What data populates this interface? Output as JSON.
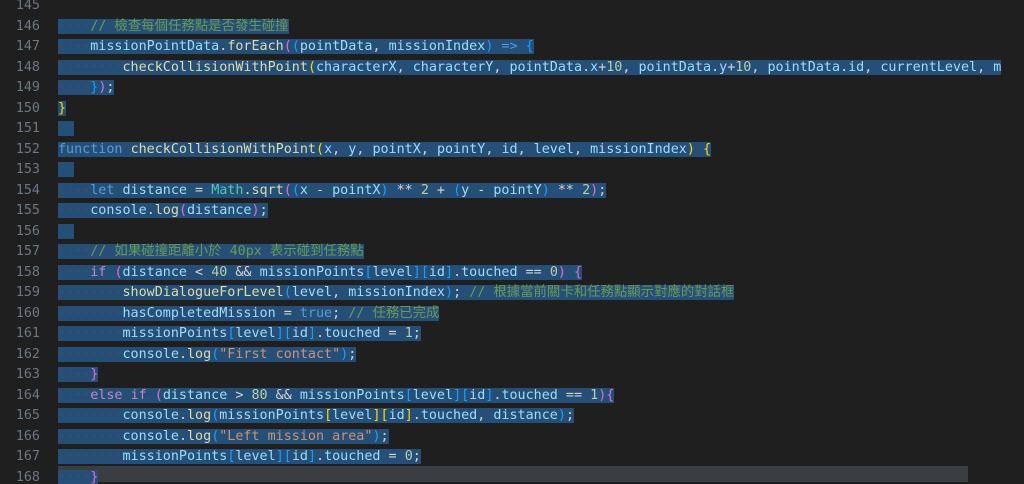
{
  "editor": {
    "lines": [
      {
        "num": "145",
        "tokens": [
          {
            "t": "",
            "c": "pl"
          }
        ],
        "sel": false
      },
      {
        "num": "146",
        "tokens": [
          {
            "t": "····",
            "c": "ws"
          },
          {
            "t": "// 檢查每個任務點是否發生碰撞",
            "c": "com"
          }
        ],
        "sel": true
      },
      {
        "num": "147",
        "tokens": [
          {
            "t": "····",
            "c": "ws"
          },
          {
            "t": "missionPointData",
            "c": "var"
          },
          {
            "t": ".",
            "c": "op"
          },
          {
            "t": "forEach",
            "c": "fn"
          },
          {
            "t": "(",
            "c": "b2"
          },
          {
            "t": "(",
            "c": "b3"
          },
          {
            "t": "pointData",
            "c": "var"
          },
          {
            "t": ", ",
            "c": "op"
          },
          {
            "t": "missionIndex",
            "c": "var"
          },
          {
            "t": ")",
            "c": "b3"
          },
          {
            "t": " ",
            "c": "op"
          },
          {
            "t": "=>",
            "c": "kw"
          },
          {
            "t": " ",
            "c": "op"
          },
          {
            "t": "{",
            "c": "b3"
          }
        ],
        "sel": true
      },
      {
        "num": "148",
        "tokens": [
          {
            "t": "········",
            "c": "ws"
          },
          {
            "t": "checkCollisionWithPoint",
            "c": "fn"
          },
          {
            "t": "(",
            "c": "b1"
          },
          {
            "t": "characterX",
            "c": "var"
          },
          {
            "t": ", ",
            "c": "op"
          },
          {
            "t": "characterY",
            "c": "var"
          },
          {
            "t": ", ",
            "c": "op"
          },
          {
            "t": "pointData",
            "c": "var"
          },
          {
            "t": ".",
            "c": "op"
          },
          {
            "t": "x",
            "c": "var"
          },
          {
            "t": "+",
            "c": "op"
          },
          {
            "t": "10",
            "c": "num"
          },
          {
            "t": ", ",
            "c": "op"
          },
          {
            "t": "pointData",
            "c": "var"
          },
          {
            "t": ".",
            "c": "op"
          },
          {
            "t": "y",
            "c": "var"
          },
          {
            "t": "+",
            "c": "op"
          },
          {
            "t": "10",
            "c": "num"
          },
          {
            "t": ", ",
            "c": "op"
          },
          {
            "t": "pointData",
            "c": "var"
          },
          {
            "t": ".",
            "c": "op"
          },
          {
            "t": "id",
            "c": "var"
          },
          {
            "t": ", ",
            "c": "op"
          },
          {
            "t": "currentLevel",
            "c": "var"
          },
          {
            "t": ", ",
            "c": "op"
          },
          {
            "t": "m",
            "c": "var"
          }
        ],
        "sel": true
      },
      {
        "num": "149",
        "tokens": [
          {
            "t": "····",
            "c": "ws"
          },
          {
            "t": "}",
            "c": "b3"
          },
          {
            "t": ")",
            "c": "b2"
          },
          {
            "t": ";",
            "c": "op"
          }
        ],
        "sel": true
      },
      {
        "num": "150",
        "tokens": [
          {
            "t": "}",
            "c": "b1"
          }
        ],
        "sel": true
      },
      {
        "num": "151",
        "tokens": [
          {
            "t": "",
            "c": "pl"
          }
        ],
        "sel": true
      },
      {
        "num": "152",
        "tokens": [
          {
            "t": "function",
            "c": "kw"
          },
          {
            "t": " ",
            "c": "op"
          },
          {
            "t": "checkCollisionWithPoint",
            "c": "fn"
          },
          {
            "t": "(",
            "c": "b1"
          },
          {
            "t": "x",
            "c": "var"
          },
          {
            "t": ", ",
            "c": "op"
          },
          {
            "t": "y",
            "c": "var"
          },
          {
            "t": ", ",
            "c": "op"
          },
          {
            "t": "pointX",
            "c": "var"
          },
          {
            "t": ", ",
            "c": "op"
          },
          {
            "t": "pointY",
            "c": "var"
          },
          {
            "t": ", ",
            "c": "op"
          },
          {
            "t": "id",
            "c": "var"
          },
          {
            "t": ", ",
            "c": "op"
          },
          {
            "t": "level",
            "c": "var"
          },
          {
            "t": ", ",
            "c": "op"
          },
          {
            "t": "missionIndex",
            "c": "var"
          },
          {
            "t": ")",
            "c": "b1"
          },
          {
            "t": " ",
            "c": "op"
          },
          {
            "t": "{",
            "c": "b1"
          }
        ],
        "sel": true
      },
      {
        "num": "153",
        "tokens": [
          {
            "t": "",
            "c": "pl"
          }
        ],
        "sel": true
      },
      {
        "num": "154",
        "tokens": [
          {
            "t": "····",
            "c": "ws"
          },
          {
            "t": "let",
            "c": "kw"
          },
          {
            "t": " ",
            "c": "op"
          },
          {
            "t": "distance",
            "c": "var"
          },
          {
            "t": " = ",
            "c": "op"
          },
          {
            "t": "Math",
            "c": "cls"
          },
          {
            "t": ".",
            "c": "op"
          },
          {
            "t": "sqrt",
            "c": "fn"
          },
          {
            "t": "(",
            "c": "b2"
          },
          {
            "t": "(",
            "c": "b3"
          },
          {
            "t": "x",
            "c": "var"
          },
          {
            "t": " - ",
            "c": "op"
          },
          {
            "t": "pointX",
            "c": "var"
          },
          {
            "t": ")",
            "c": "b3"
          },
          {
            "t": " ** ",
            "c": "op"
          },
          {
            "t": "2",
            "c": "num"
          },
          {
            "t": " + ",
            "c": "op"
          },
          {
            "t": "(",
            "c": "b3"
          },
          {
            "t": "y",
            "c": "var"
          },
          {
            "t": " - ",
            "c": "op"
          },
          {
            "t": "pointY",
            "c": "var"
          },
          {
            "t": ")",
            "c": "b3"
          },
          {
            "t": " ** ",
            "c": "op"
          },
          {
            "t": "2",
            "c": "num"
          },
          {
            "t": ")",
            "c": "b2"
          },
          {
            "t": ";",
            "c": "op"
          }
        ],
        "sel": true
      },
      {
        "num": "155",
        "tokens": [
          {
            "t": "····",
            "c": "ws"
          },
          {
            "t": "console",
            "c": "var"
          },
          {
            "t": ".",
            "c": "op"
          },
          {
            "t": "log",
            "c": "fn"
          },
          {
            "t": "(",
            "c": "b2"
          },
          {
            "t": "distance",
            "c": "var"
          },
          {
            "t": ")",
            "c": "b2"
          },
          {
            "t": ";",
            "c": "op"
          }
        ],
        "sel": true
      },
      {
        "num": "156",
        "tokens": [
          {
            "t": "",
            "c": "pl"
          }
        ],
        "sel": true
      },
      {
        "num": "157",
        "tokens": [
          {
            "t": "····",
            "c": "ws"
          },
          {
            "t": "// 如果碰撞距離小於 40px 表示碰到任務點",
            "c": "com"
          }
        ],
        "sel": true
      },
      {
        "num": "158",
        "tokens": [
          {
            "t": "····",
            "c": "ws"
          },
          {
            "t": "if",
            "c": "ctl"
          },
          {
            "t": " ",
            "c": "op"
          },
          {
            "t": "(",
            "c": "b2"
          },
          {
            "t": "distance",
            "c": "var"
          },
          {
            "t": " < ",
            "c": "op"
          },
          {
            "t": "40",
            "c": "num"
          },
          {
            "t": " && ",
            "c": "op"
          },
          {
            "t": "missionPoints",
            "c": "var"
          },
          {
            "t": "[",
            "c": "b3"
          },
          {
            "t": "level",
            "c": "var"
          },
          {
            "t": "]",
            "c": "b3"
          },
          {
            "t": "[",
            "c": "b3"
          },
          {
            "t": "id",
            "c": "var"
          },
          {
            "t": "]",
            "c": "b3"
          },
          {
            "t": ".",
            "c": "op"
          },
          {
            "t": "touched",
            "c": "var"
          },
          {
            "t": " == ",
            "c": "op"
          },
          {
            "t": "0",
            "c": "num"
          },
          {
            "t": ")",
            "c": "b2"
          },
          {
            "t": " ",
            "c": "op"
          },
          {
            "t": "{",
            "c": "b2"
          }
        ],
        "sel": true
      },
      {
        "num": "159",
        "tokens": [
          {
            "t": "········",
            "c": "ws"
          },
          {
            "t": "showDialogueForLevel",
            "c": "fn"
          },
          {
            "t": "(",
            "c": "b3"
          },
          {
            "t": "level",
            "c": "var"
          },
          {
            "t": ", ",
            "c": "op"
          },
          {
            "t": "missionIndex",
            "c": "var"
          },
          {
            "t": ")",
            "c": "b3"
          },
          {
            "t": "; ",
            "c": "op"
          },
          {
            "t": "// 根據當前關卡和任務點顯示對應的對話框",
            "c": "com"
          }
        ],
        "sel": true
      },
      {
        "num": "160",
        "tokens": [
          {
            "t": "········",
            "c": "ws"
          },
          {
            "t": "hasCompletedMission",
            "c": "var"
          },
          {
            "t": " = ",
            "c": "op"
          },
          {
            "t": "true",
            "c": "kw"
          },
          {
            "t": "; ",
            "c": "op"
          },
          {
            "t": "// 任務已完成",
            "c": "com"
          }
        ],
        "sel": true
      },
      {
        "num": "161",
        "tokens": [
          {
            "t": "········",
            "c": "ws"
          },
          {
            "t": "missionPoints",
            "c": "var"
          },
          {
            "t": "[",
            "c": "b3"
          },
          {
            "t": "level",
            "c": "var"
          },
          {
            "t": "]",
            "c": "b3"
          },
          {
            "t": "[",
            "c": "b3"
          },
          {
            "t": "id",
            "c": "var"
          },
          {
            "t": "]",
            "c": "b3"
          },
          {
            "t": ".",
            "c": "op"
          },
          {
            "t": "touched",
            "c": "var"
          },
          {
            "t": " = ",
            "c": "op"
          },
          {
            "t": "1",
            "c": "num"
          },
          {
            "t": ";",
            "c": "op"
          }
        ],
        "sel": true
      },
      {
        "num": "162",
        "tokens": [
          {
            "t": "········",
            "c": "ws"
          },
          {
            "t": "console",
            "c": "var"
          },
          {
            "t": ".",
            "c": "op"
          },
          {
            "t": "log",
            "c": "fn"
          },
          {
            "t": "(",
            "c": "b3"
          },
          {
            "t": "\"First contact\"",
            "c": "str"
          },
          {
            "t": ")",
            "c": "b3"
          },
          {
            "t": ";",
            "c": "op"
          }
        ],
        "sel": true
      },
      {
        "num": "163",
        "tokens": [
          {
            "t": "····",
            "c": "ws"
          },
          {
            "t": "}",
            "c": "b2"
          }
        ],
        "sel": true
      },
      {
        "num": "164",
        "tokens": [
          {
            "t": "····",
            "c": "ws"
          },
          {
            "t": "else",
            "c": "ctl"
          },
          {
            "t": " ",
            "c": "op"
          },
          {
            "t": "if",
            "c": "ctl"
          },
          {
            "t": " ",
            "c": "op"
          },
          {
            "t": "(",
            "c": "b2"
          },
          {
            "t": "distance",
            "c": "var"
          },
          {
            "t": " > ",
            "c": "op"
          },
          {
            "t": "80",
            "c": "num"
          },
          {
            "t": " && ",
            "c": "op"
          },
          {
            "t": "missionPoints",
            "c": "var"
          },
          {
            "t": "[",
            "c": "b3"
          },
          {
            "t": "level",
            "c": "var"
          },
          {
            "t": "]",
            "c": "b3"
          },
          {
            "t": "[",
            "c": "b3"
          },
          {
            "t": "id",
            "c": "var"
          },
          {
            "t": "]",
            "c": "b3"
          },
          {
            "t": ".",
            "c": "op"
          },
          {
            "t": "touched",
            "c": "var"
          },
          {
            "t": " == ",
            "c": "op"
          },
          {
            "t": "1",
            "c": "num"
          },
          {
            "t": ")",
            "c": "b2"
          },
          {
            "t": "{",
            "c": "b2"
          }
        ],
        "sel": true
      },
      {
        "num": "165",
        "tokens": [
          {
            "t": "········",
            "c": "ws"
          },
          {
            "t": "console",
            "c": "var"
          },
          {
            "t": ".",
            "c": "op"
          },
          {
            "t": "log",
            "c": "fn"
          },
          {
            "t": "(",
            "c": "b3"
          },
          {
            "t": "missionPoints",
            "c": "var"
          },
          {
            "t": "[",
            "c": "b1"
          },
          {
            "t": "level",
            "c": "var"
          },
          {
            "t": "]",
            "c": "b1"
          },
          {
            "t": "[",
            "c": "b1"
          },
          {
            "t": "id",
            "c": "var"
          },
          {
            "t": "]",
            "c": "b1"
          },
          {
            "t": ".",
            "c": "op"
          },
          {
            "t": "touched",
            "c": "var"
          },
          {
            "t": ", ",
            "c": "op"
          },
          {
            "t": "distance",
            "c": "var"
          },
          {
            "t": ")",
            "c": "b3"
          },
          {
            "t": ";",
            "c": "op"
          }
        ],
        "sel": true
      },
      {
        "num": "166",
        "tokens": [
          {
            "t": "········",
            "c": "ws"
          },
          {
            "t": "console",
            "c": "var"
          },
          {
            "t": ".",
            "c": "op"
          },
          {
            "t": "log",
            "c": "fn"
          },
          {
            "t": "(",
            "c": "b3"
          },
          {
            "t": "\"Left mission area\"",
            "c": "str"
          },
          {
            "t": ")",
            "c": "b3"
          },
          {
            "t": ";",
            "c": "op"
          }
        ],
        "sel": true
      },
      {
        "num": "167",
        "tokens": [
          {
            "t": "········",
            "c": "ws"
          },
          {
            "t": "missionPoints",
            "c": "var"
          },
          {
            "t": "[",
            "c": "b3"
          },
          {
            "t": "level",
            "c": "var"
          },
          {
            "t": "]",
            "c": "b3"
          },
          {
            "t": "[",
            "c": "b3"
          },
          {
            "t": "id",
            "c": "var"
          },
          {
            "t": "]",
            "c": "b3"
          },
          {
            "t": ".",
            "c": "op"
          },
          {
            "t": "touched",
            "c": "var"
          },
          {
            "t": " = ",
            "c": "op"
          },
          {
            "t": "0",
            "c": "num"
          },
          {
            "t": ";",
            "c": "op"
          }
        ],
        "sel": true
      },
      {
        "num": "168",
        "tokens": [
          {
            "t": "····",
            "c": "ws"
          },
          {
            "t": "}",
            "c": "b2"
          }
        ],
        "sel": true
      }
    ]
  }
}
